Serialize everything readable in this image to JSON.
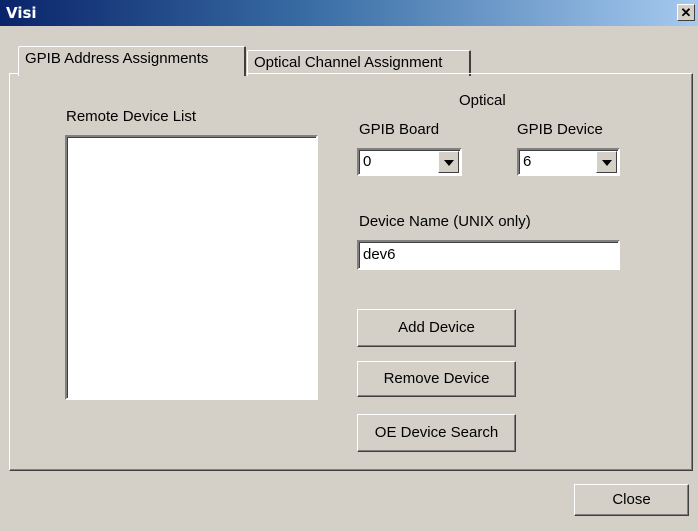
{
  "window": {
    "title": "Visi"
  },
  "tabs": [
    {
      "label": "GPIB Address Assignments",
      "active": true
    },
    {
      "label": "Optical Channel Assignment",
      "active": false
    }
  ],
  "remote_list": {
    "label": "Remote Device List",
    "items": []
  },
  "optical": {
    "group_label": "Optical",
    "gpib_board_label": "GPIB Board",
    "gpib_board_value": "0",
    "gpib_device_label": "GPIB Device",
    "gpib_device_value": "6"
  },
  "device_name": {
    "label": "Device Name (UNIX only)",
    "value": "dev6"
  },
  "buttons": {
    "add": "Add Device",
    "remove": "Remove Device",
    "search": "OE Device Search",
    "close": "Close"
  },
  "icons": {
    "window_close": "close-icon",
    "dropdown": "chevron-down-icon"
  }
}
